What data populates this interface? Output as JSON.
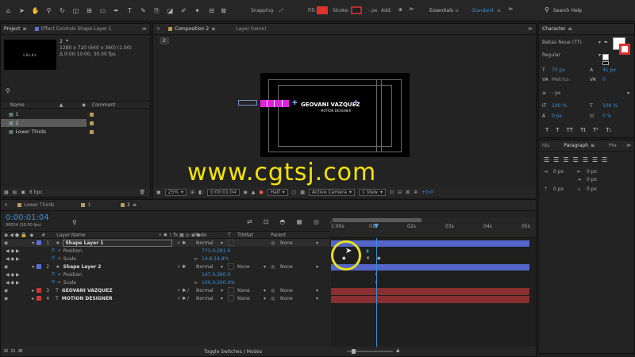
{
  "toolbar": {
    "snapping_label": "Snapping",
    "fill_label": "Fill:",
    "stroke_label": "Stroke:",
    "stroke_px": "- px",
    "add_label": "Add:",
    "workspace_essentials": "Essentials",
    "workspace_standard": "Standard",
    "search_placeholder": "Search Help",
    "fill_color": "#e03030",
    "accent": "#3a8fd6"
  },
  "project": {
    "tab_label": "Project",
    "effect_tab_label": "Effect Controls Shape Layer 1",
    "item_name": "2",
    "item_info1": "1280 x 720  (640 x 360) (1.00)",
    "item_info2": "Δ 0:00:10:00, 30.00 fps",
    "col_name": "Name",
    "col_comment": "Comment",
    "items": [
      {
        "name": "1"
      },
      {
        "name": "2"
      },
      {
        "name": "Lower Thirds"
      }
    ],
    "bpc": "8 bpc",
    "thumb_text": "LALAL"
  },
  "composition": {
    "tab_label": "Composition 2",
    "layer_tab_label": "Layer (none)",
    "flow_label": "2",
    "name_text": "GEOVANI VAZQUEZ",
    "role_text": "MOTION DESIGNER",
    "zoom": "25%",
    "timecode": "0:00:01:04",
    "resolution": "Half",
    "camera": "Active Camera",
    "views": "1 View",
    "exposure": "+0.0"
  },
  "watermark": "www.cgtsj.com",
  "character": {
    "tab_label": "Character",
    "font_name": "Bebas Neue (TT)",
    "font_style": "Regular",
    "font_size": "70 px",
    "leading": "41 px",
    "kerning": "Metrics",
    "tracking": "0",
    "stroke_width": "- px",
    "vscale": "100 %",
    "hscale": "100 %",
    "baseline": "0 px",
    "tsume": "0 %",
    "style_buttons": [
      "T",
      "T",
      "TT",
      "Tt",
      "T¹",
      "T₁"
    ]
  },
  "paragraph": {
    "tab_left": "nts",
    "tab_label": "Paragraph",
    "tab_right": "Pre",
    "indent_values": [
      "0 px",
      "0 px",
      "0 px",
      "0 px",
      "0 px"
    ]
  },
  "timeline": {
    "tabs": [
      {
        "label": "Lower Thirds",
        "color": "#b79a5a"
      },
      {
        "label": "1",
        "color": "#b79a5a"
      },
      {
        "label": "2",
        "color": "#b79a5a"
      }
    ],
    "timecode": "0:00:01:04",
    "frame_info": "00034 (30.00 fps)",
    "col_num": "#",
    "col_layer_name": "Layer Name",
    "col_mode": "Mode",
    "col_t": "T",
    "col_trkmat": "TrkMat",
    "col_parent": "Parent",
    "ruler": [
      "1:00s",
      "01s",
      "02s",
      "03s",
      "04s",
      "05s"
    ],
    "layers": [
      {
        "num": "1",
        "name": "Shape Layer 1",
        "mode": "Normal",
        "trkmat": "",
        "parent": "None",
        "color": "#5c6fd6"
      },
      {
        "num": "2",
        "name": "Shape Layer 2",
        "mode": "Normal",
        "trkmat": "None",
        "parent": "None",
        "color": "#5c6fd6"
      },
      {
        "num": "3",
        "name": "GEOVANI VAZQUEZ",
        "mode": "Normal",
        "trkmat": "None",
        "parent": "None",
        "color": "#c63a3a"
      },
      {
        "num": "4",
        "name": "MOTION DESIGNER",
        "mode": "Normal",
        "trkmat": "None",
        "parent": "None",
        "color": "#c63a3a"
      }
    ],
    "props1": [
      {
        "name": "Position",
        "value": "773.0,281.0"
      },
      {
        "name": "Scale",
        "value": "14.8,14.8%"
      }
    ],
    "props2": [
      {
        "name": "Position",
        "value": "167.0,360.0"
      },
      {
        "name": "Scale",
        "value": "100.0,100.0%"
      }
    ],
    "toggle_label": "Toggle Switches / Modes"
  }
}
